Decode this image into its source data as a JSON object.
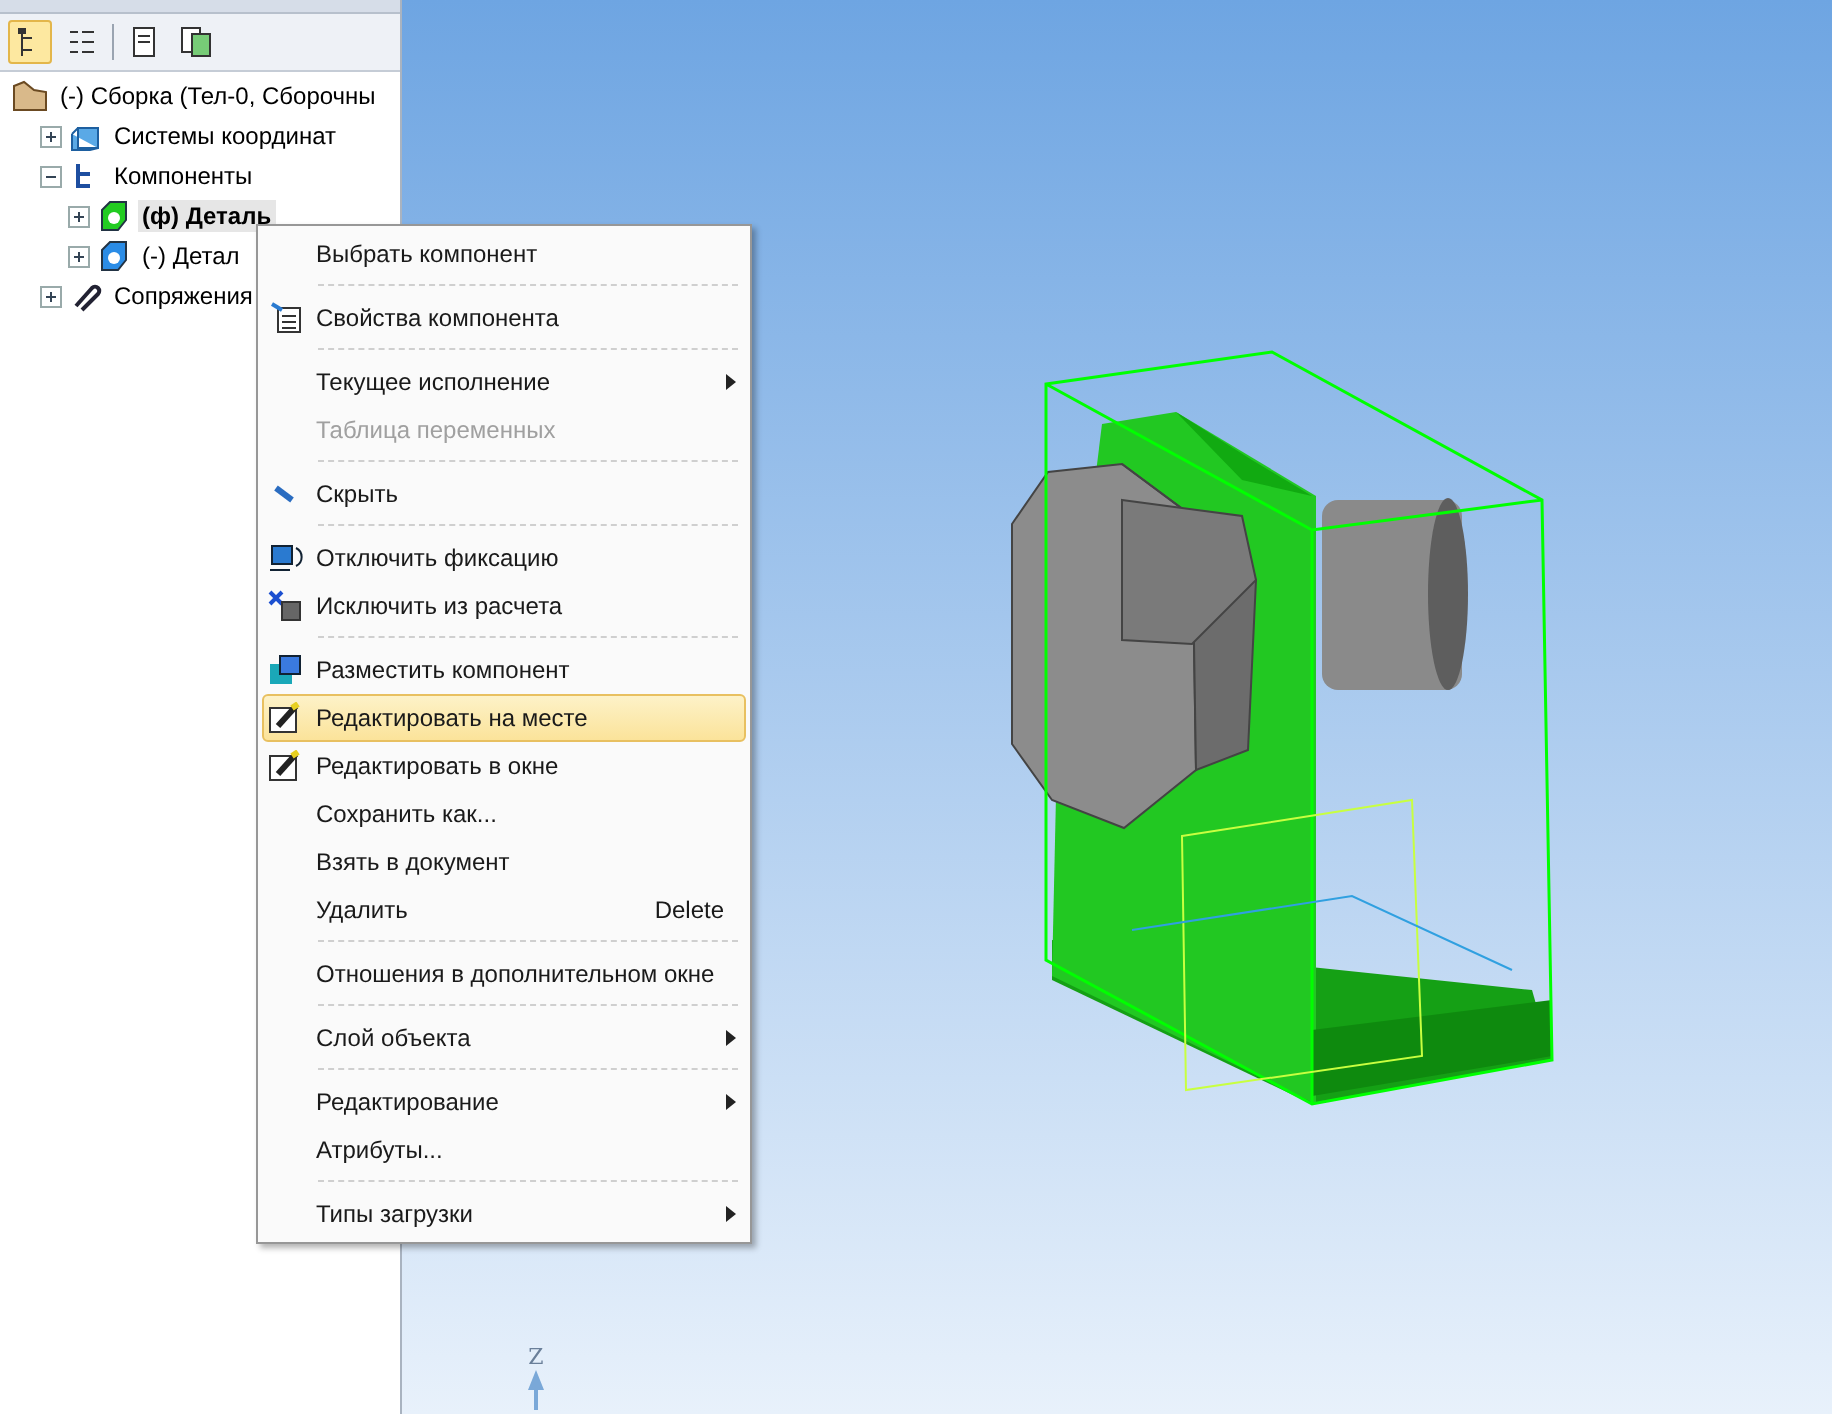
{
  "toolbar": [
    {
      "kind": "tree",
      "selected": true
    },
    {
      "kind": "list",
      "selected": false
    },
    {
      "kind": "page",
      "selected": false
    },
    {
      "kind": "pages",
      "selected": false
    }
  ],
  "tree": {
    "label": "(-) Сборка (Тел-0, Сборочны",
    "kind": "assembly",
    "children": [
      {
        "label": "Системы координат",
        "kind": "coords",
        "expanded": false,
        "bold": false,
        "selected": false
      },
      {
        "label": "Компоненты",
        "kind": "components",
        "expanded": true,
        "bold": false,
        "selected": false,
        "children": [
          {
            "label": "(ф) Деталь",
            "kind": "part",
            "color": "#22cc22",
            "expanded": false,
            "bold": true,
            "selected": true
          },
          {
            "label": "(-) Детал",
            "kind": "part",
            "color": "#2a8ce6",
            "expanded": false,
            "bold": false,
            "selected": false
          }
        ]
      },
      {
        "label": "Сопряжения",
        "kind": "mates",
        "expanded": false,
        "bold": false,
        "selected": false
      }
    ]
  },
  "menu": [
    {
      "kind": "item",
      "label": "Выбрать компонент",
      "disabled": false,
      "selected": false,
      "submenu": false
    },
    {
      "kind": "separator"
    },
    {
      "kind": "item",
      "label": "Свойства компонента",
      "disabled": false,
      "selected": false,
      "submenu": false
    },
    {
      "kind": "separator"
    },
    {
      "kind": "item",
      "label": "Текущее исполнение",
      "disabled": false,
      "selected": false,
      "submenu": true
    },
    {
      "kind": "item",
      "label": "Таблица переменных",
      "disabled": true,
      "selected": false,
      "submenu": false
    },
    {
      "kind": "separator"
    },
    {
      "kind": "item",
      "label": "Скрыть",
      "disabled": false,
      "selected": false,
      "submenu": false
    },
    {
      "kind": "separator"
    },
    {
      "kind": "item",
      "label": "Отключить фиксацию",
      "disabled": false,
      "selected": false,
      "submenu": false
    },
    {
      "kind": "item",
      "label": "Исключить из расчета",
      "disabled": false,
      "selected": false,
      "submenu": false
    },
    {
      "kind": "separator"
    },
    {
      "kind": "item",
      "label": "Разместить компонент",
      "disabled": false,
      "selected": false,
      "submenu": false
    },
    {
      "kind": "item",
      "label": "Редактировать на месте",
      "disabled": false,
      "selected": true,
      "submenu": false
    },
    {
      "kind": "item",
      "label": "Редактировать в окне",
      "disabled": false,
      "selected": false,
      "submenu": false
    },
    {
      "kind": "item",
      "label": "Сохранить как...",
      "disabled": false,
      "selected": false,
      "submenu": false
    },
    {
      "kind": "item",
      "label": "Взять в документ",
      "disabled": false,
      "selected": false,
      "submenu": false
    },
    {
      "kind": "item",
      "label": "Удалить",
      "disabled": false,
      "selected": false,
      "submenu": false,
      "shortcut": "Delete"
    },
    {
      "kind": "separator"
    },
    {
      "kind": "item",
      "label": "Отношения в дополнительном окне",
      "disabled": false,
      "selected": false,
      "submenu": false
    },
    {
      "kind": "separator"
    },
    {
      "kind": "item",
      "label": "Слой объекта",
      "disabled": false,
      "selected": false,
      "submenu": true
    },
    {
      "kind": "separator"
    },
    {
      "kind": "item",
      "label": "Редактирование",
      "disabled": false,
      "selected": false,
      "submenu": true
    },
    {
      "kind": "item",
      "label": "Атрибуты...",
      "disabled": false,
      "selected": false,
      "submenu": false
    },
    {
      "kind": "separator"
    },
    {
      "kind": "item",
      "label": "Типы загрузки",
      "disabled": false,
      "selected": false,
      "submenu": true
    }
  ],
  "viewport": {
    "axis_label": "Z"
  }
}
